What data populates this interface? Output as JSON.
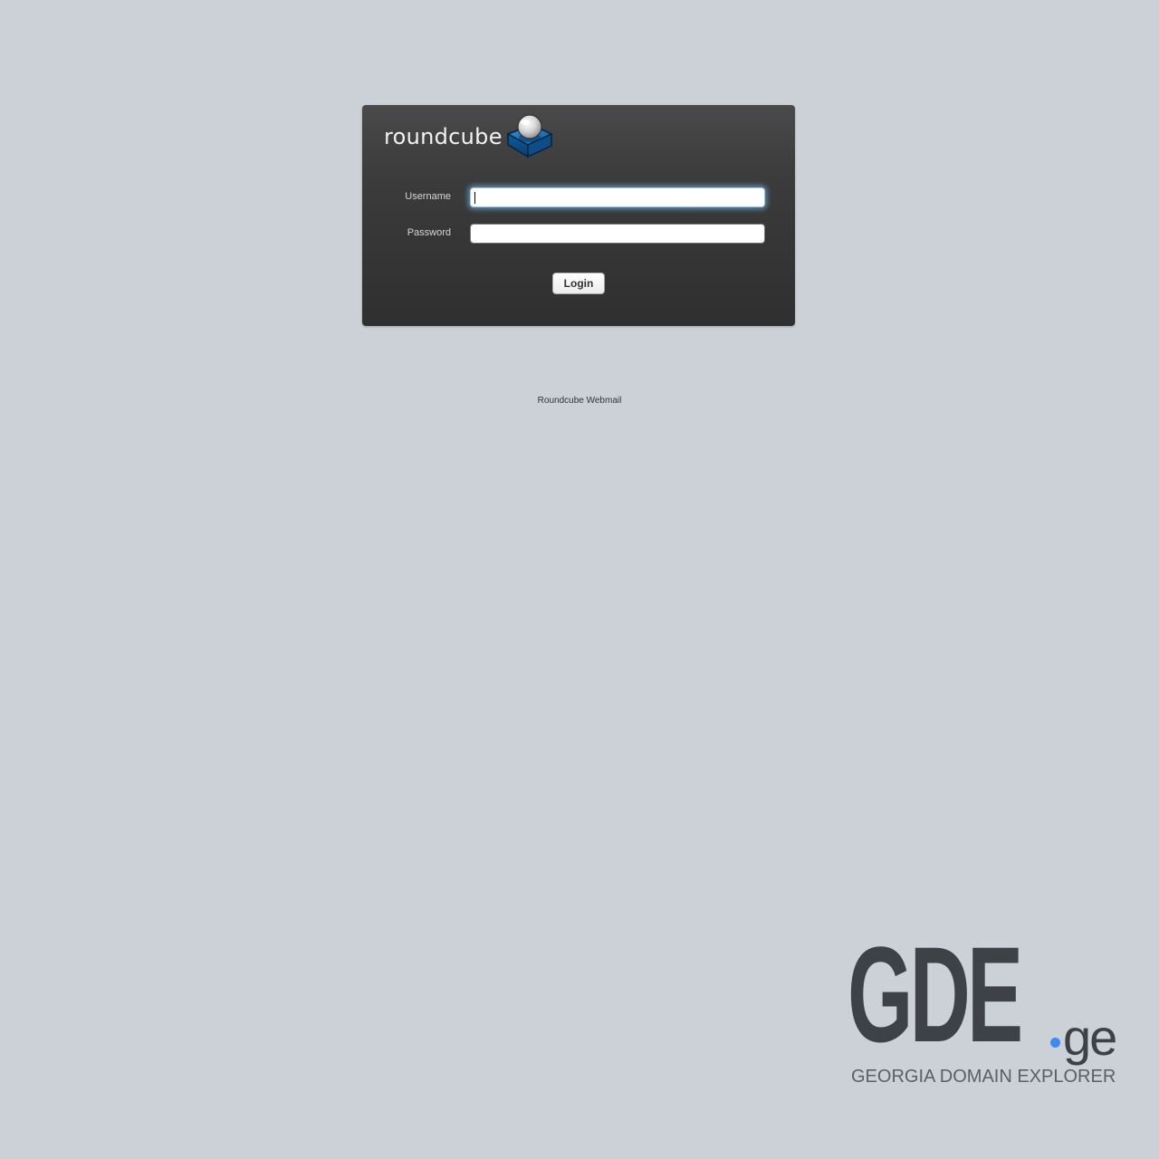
{
  "app": {
    "name": "roundcube",
    "footer": "Roundcube Webmail"
  },
  "logo": {
    "text": "roundcube",
    "icon": "roundcube-cube-icon"
  },
  "form": {
    "username_label": "Username",
    "username_value": "",
    "password_label": "Password",
    "password_value": "",
    "focused_field": "username",
    "submit_label": "Login"
  },
  "watermark": {
    "main": "GDE",
    "tld": "ge",
    "subtitle": "GEORGIA DOMAIN EXPLORER",
    "accent_color": "#3b8cef"
  },
  "colors": {
    "background": "#cbd1d7",
    "panel": "#3c3c3c",
    "focus_glow": "#6eb4e6"
  }
}
